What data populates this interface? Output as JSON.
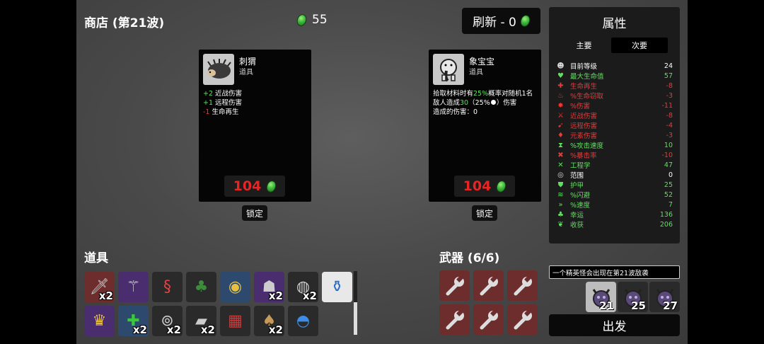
{
  "header": {
    "shop_title": "商店 (第21波)",
    "materials": "55",
    "reroll_label": "刷新 - 0"
  },
  "shop_cards": [
    {
      "name": "刺猬",
      "type": "道具",
      "icon": "hedgehog-icon",
      "effects": [
        {
          "sign": "+2",
          "text": " 近战伤害",
          "sign_color": "#5ee05e"
        },
        {
          "sign": "+1",
          "text": " 远程伤害",
          "sign_color": "#5ee05e"
        },
        {
          "sign": "-1",
          "text": " 生命再生",
          "sign_color": "#e83a3a"
        }
      ],
      "price": "104",
      "lock_label": "锁定"
    },
    {
      "name": "象宝宝",
      "type": "道具",
      "icon": "baby-elephant-icon",
      "desc_parts": [
        "拾取材料时有",
        "25%",
        "概率对随机1名敌人造成",
        "30",
        "（25%",
        "）伤害"
      ],
      "damage_done": "造成的伤害：0",
      "price": "104",
      "lock_label": "锁定"
    }
  ],
  "stats_panel": {
    "title": "属性",
    "tabs": [
      {
        "label": "主要"
      },
      {
        "label": "次要"
      }
    ],
    "rows": [
      {
        "label": "目前等级",
        "value": "24",
        "color": "#ffffff",
        "icon": "level-icon"
      },
      {
        "label": "最大生命值",
        "value": "57",
        "color": "#5ee05e",
        "icon": "heart-icon"
      },
      {
        "label": "生命再生",
        "value": "-8",
        "color": "#e83a3a",
        "icon": "regen-icon"
      },
      {
        "label": "%生命窃取",
        "value": "-3",
        "color": "#e83a3a",
        "icon": "lifesteal-icon"
      },
      {
        "label": "%伤害",
        "value": "-11",
        "color": "#e83a3a",
        "icon": "damage-icon"
      },
      {
        "label": "近战伤害",
        "value": "-8",
        "color": "#e83a3a",
        "icon": "melee-icon"
      },
      {
        "label": "远程伤害",
        "value": "-4",
        "color": "#e83a3a",
        "icon": "ranged-icon"
      },
      {
        "label": "元素伤害",
        "value": "-3",
        "color": "#e83a3a",
        "icon": "elemental-icon"
      },
      {
        "label": "%攻击速度",
        "value": "10",
        "color": "#5ee05e",
        "icon": "attack-speed-icon"
      },
      {
        "label": "%暴击率",
        "value": "-10",
        "color": "#e83a3a",
        "icon": "crit-icon"
      },
      {
        "label": "工程学",
        "value": "47",
        "color": "#5ee05e",
        "icon": "engineering-icon"
      },
      {
        "label": "范围",
        "value": "0",
        "color": "#ffffff",
        "icon": "range-icon"
      },
      {
        "label": "护甲",
        "value": "25",
        "color": "#5ee05e",
        "icon": "armor-icon"
      },
      {
        "label": "%闪避",
        "value": "52",
        "color": "#5ee05e",
        "icon": "dodge-icon"
      },
      {
        "label": "%速度",
        "value": "7",
        "color": "#5ee05e",
        "icon": "speed-icon"
      },
      {
        "label": "幸运",
        "value": "136",
        "color": "#5ee05e",
        "icon": "luck-icon"
      },
      {
        "label": "收获",
        "value": "206",
        "color": "#5ee05e",
        "icon": "harvest-icon"
      }
    ]
  },
  "items_section": {
    "title": "道具",
    "items": [
      {
        "icon": "sword-dagger-icon",
        "bg": "#6e2d2d",
        "qty": "x2"
      },
      {
        "icon": "wand-icon",
        "bg": "#4a2d6e",
        "qty": ""
      },
      {
        "icon": "snake-icon",
        "bg": "#2a2a2a",
        "qty": ""
      },
      {
        "icon": "tree-icon",
        "bg": "#2a2a2a",
        "qty": ""
      },
      {
        "icon": "pendant-icon",
        "bg": "#2d4a6e",
        "qty": ""
      },
      {
        "icon": "cat-icon",
        "bg": "#4a2d6e",
        "qty": "x2"
      },
      {
        "icon": "mirror-icon",
        "bg": "#2a2a2a",
        "qty": "x2"
      },
      {
        "icon": "potion-icon",
        "bg": "#e8e8e8",
        "qty": ""
      },
      {
        "icon": "crown-icon",
        "bg": "#4a2d6e",
        "qty": ""
      },
      {
        "icon": "medkit-icon",
        "bg": "#2d4a6e",
        "qty": "x2"
      },
      {
        "icon": "coin-pouch-icon",
        "bg": "#2a2a2a",
        "qty": "x2"
      },
      {
        "icon": "metal-plate-icon",
        "bg": "#2a2a2a",
        "qty": "x2"
      },
      {
        "icon": "flannel-shirt-icon",
        "bg": "#2a2a2a",
        "qty": ""
      },
      {
        "icon": "mushroom-icon",
        "bg": "#2a2a2a",
        "qty": "x2"
      },
      {
        "icon": "propeller-hat-icon",
        "bg": "#2a2a2a",
        "qty": ""
      }
    ]
  },
  "weapons_section": {
    "title": "武器 (6/6)",
    "count": 6
  },
  "wave_info": {
    "message": "一个精英怪会出现在第21波敌袭",
    "enemies": [
      {
        "wave": "21",
        "bg": "#bdbdbd"
      },
      {
        "wave": "25",
        "bg": "#2a2a2a"
      },
      {
        "wave": "27",
        "bg": "#2a2a2a"
      }
    ]
  },
  "go_button": "出发"
}
